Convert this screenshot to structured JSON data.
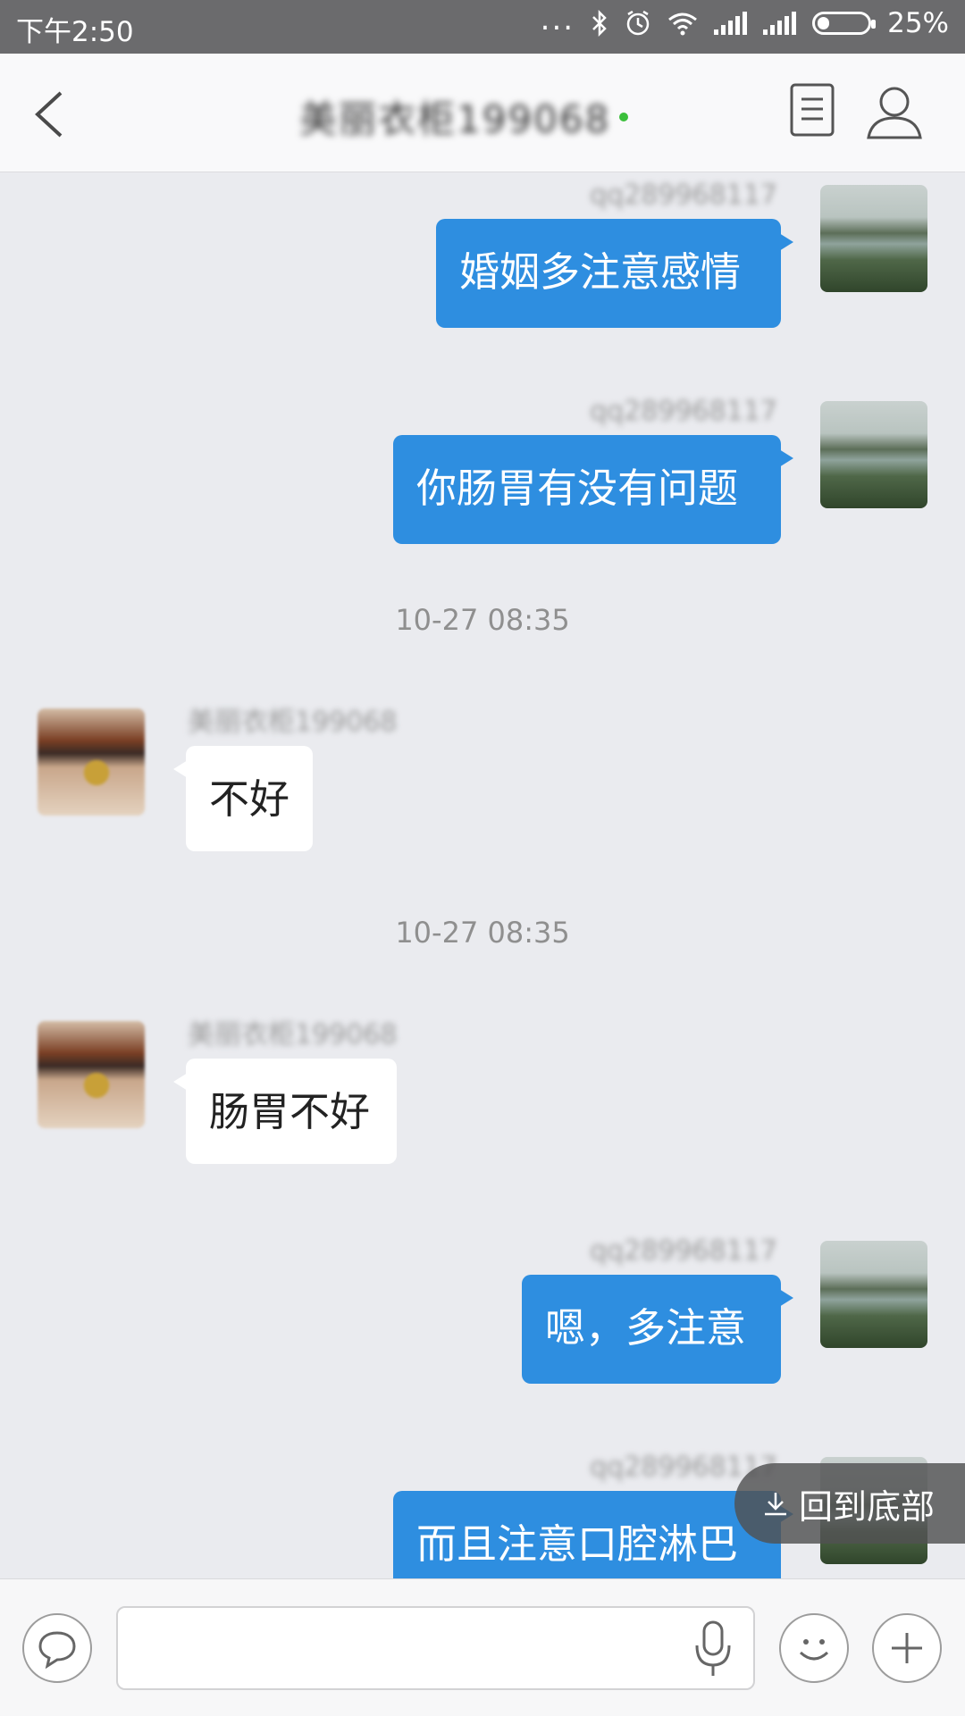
{
  "status_bar": {
    "time": "下午2:50",
    "dots": "...",
    "battery_text": "25%",
    "battery_level": 0.25
  },
  "header": {
    "title": "美丽衣柜199068",
    "back_icon": "chevron-left-icon",
    "doc_icon": "document-icon",
    "profile_icon": "user-icon"
  },
  "messages": [
    {
      "side": "out",
      "sender": "qq289968117",
      "text": "婚姻多注意感情"
    },
    {
      "side": "out",
      "sender": "qq289968117",
      "text": "你肠胃有没有问题"
    },
    {
      "type": "time",
      "text": "10-27 08:35"
    },
    {
      "side": "in",
      "sender": "美丽衣柜199068",
      "text": "不好"
    },
    {
      "type": "time",
      "text": "10-27 08:35"
    },
    {
      "side": "in",
      "sender": "美丽衣柜199068",
      "text": "肠胃不好"
    },
    {
      "side": "out",
      "sender": "qq289968117",
      "text": "嗯，多注意"
    },
    {
      "side": "out",
      "sender": "qq289968117",
      "text": "而且注意口腔淋巴"
    }
  ],
  "back_to_bottom": {
    "label": "回到底部",
    "icon": "download-arrow-icon"
  },
  "input_bar": {
    "placeholder": "",
    "chat_icon": "chat-bubble-icon",
    "mic_icon": "microphone-icon",
    "emoji_icon": "smiley-icon",
    "plus_icon": "plus-icon"
  },
  "colors": {
    "outgoing_bubble": "#2e8ee0",
    "incoming_bubble": "#ffffff",
    "background": "#eaebef",
    "status_bar": "#6b6b6d"
  }
}
